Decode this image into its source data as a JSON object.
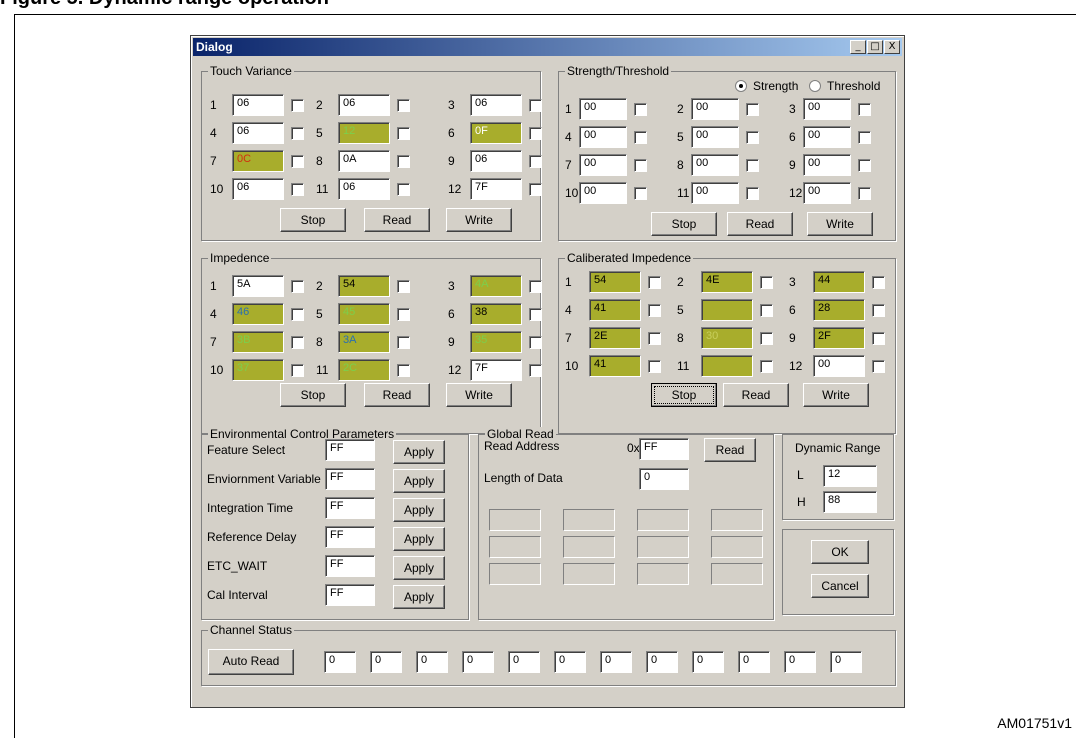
{
  "caption": "Figure 5. Dynamic range operation",
  "footer_code": "AM01751v1",
  "window": {
    "title": "Dialog",
    "minimize": "_",
    "maximize": "□",
    "close": "X"
  },
  "touch_variance": {
    "label": "Touch Variance",
    "cells": [
      {
        "n": "1",
        "v": "06",
        "hl": false
      },
      {
        "n": "2",
        "v": "06",
        "hl": false
      },
      {
        "n": "3",
        "v": "06",
        "hl": false
      },
      {
        "n": "4",
        "v": "06",
        "hl": false
      },
      {
        "n": "5",
        "v": "12",
        "hl": true,
        "color": "#7ccf4c"
      },
      {
        "n": "6",
        "v": "0F",
        "hl": true,
        "color": "#ffffff"
      },
      {
        "n": "7",
        "v": "0C",
        "hl": true,
        "color": "#d03010"
      },
      {
        "n": "8",
        "v": "0A",
        "hl": false
      },
      {
        "n": "9",
        "v": "06",
        "hl": false
      },
      {
        "n": "10",
        "v": "06",
        "hl": false
      },
      {
        "n": "11",
        "v": "06",
        "hl": false
      },
      {
        "n": "12",
        "v": "7F",
        "hl": false
      }
    ],
    "stop": "Stop",
    "read": "Read",
    "write": "Write"
  },
  "strength_threshold": {
    "label": "Strength/Threshold",
    "radio_strength": "Strength",
    "radio_threshold": "Threshold",
    "cells": [
      {
        "n": "1",
        "v": "00"
      },
      {
        "n": "2",
        "v": "00"
      },
      {
        "n": "3",
        "v": "00"
      },
      {
        "n": "4",
        "v": "00"
      },
      {
        "n": "5",
        "v": "00"
      },
      {
        "n": "6",
        "v": "00"
      },
      {
        "n": "7",
        "v": "00"
      },
      {
        "n": "8",
        "v": "00"
      },
      {
        "n": "9",
        "v": "00"
      },
      {
        "n": "10",
        "v": "00"
      },
      {
        "n": "11",
        "v": "00"
      },
      {
        "n": "12",
        "v": "00"
      }
    ],
    "stop": "Stop",
    "read": "Read",
    "write": "Write"
  },
  "impedence": {
    "label": "Impedence",
    "cells": [
      {
        "n": "1",
        "v": "5A",
        "hl": false
      },
      {
        "n": "2",
        "v": "54",
        "hl": true,
        "color": "#000000"
      },
      {
        "n": "3",
        "v": "4A",
        "hl": true,
        "color": "#7ccf4c"
      },
      {
        "n": "4",
        "v": "46",
        "hl": true,
        "color": "#2a6fb0"
      },
      {
        "n": "5",
        "v": "45",
        "hl": true,
        "color": "#7ccf4c"
      },
      {
        "n": "6",
        "v": "38",
        "hl": true,
        "color": "#000000"
      },
      {
        "n": "7",
        "v": "3B",
        "hl": true,
        "color": "#7ccf4c"
      },
      {
        "n": "8",
        "v": "3A",
        "hl": true,
        "color": "#2a6fb0"
      },
      {
        "n": "9",
        "v": "35",
        "hl": true,
        "color": "#7ccf4c"
      },
      {
        "n": "10",
        "v": "37",
        "hl": true,
        "color": "#7ccf4c"
      },
      {
        "n": "11",
        "v": "2C",
        "hl": true,
        "color": "#7ccf4c"
      },
      {
        "n": "12",
        "v": "7F",
        "hl": false
      }
    ],
    "stop": "Stop",
    "read": "Read",
    "write": "Write"
  },
  "calibrated_impedence": {
    "label": "Caliberated Impedence",
    "cells": [
      {
        "n": "1",
        "v": "54",
        "hl": true,
        "color": "#000000"
      },
      {
        "n": "2",
        "v": "4E",
        "hl": true,
        "color": "#000000"
      },
      {
        "n": "3",
        "v": "44",
        "hl": true,
        "color": "#000000"
      },
      {
        "n": "4",
        "v": "41",
        "hl": true,
        "color": "#000000"
      },
      {
        "n": "5",
        "v": "40",
        "hl": true,
        "color": "#a8ad2c"
      },
      {
        "n": "6",
        "v": "28",
        "hl": true,
        "color": "#000000"
      },
      {
        "n": "7",
        "v": "2E",
        "hl": true,
        "color": "#000000"
      },
      {
        "n": "8",
        "v": "30",
        "hl": true,
        "color": "#c8cf5c"
      },
      {
        "n": "9",
        "v": "2F",
        "hl": true,
        "color": "#000000"
      },
      {
        "n": "10",
        "v": "41",
        "hl": true,
        "color": "#000000"
      },
      {
        "n": "11",
        "v": "3E",
        "hl": true,
        "color": "#a8ad2c"
      },
      {
        "n": "12",
        "v": "00",
        "hl": false
      }
    ],
    "stop": "Stop",
    "read": "Read",
    "write": "Write"
  },
  "env_params": {
    "label": "Environmental Control Parameters",
    "apply": "Apply",
    "rows": [
      {
        "label": "Feature Select",
        "value": "FF"
      },
      {
        "label": "Enviornment Variable",
        "value": "FF"
      },
      {
        "label": "Integration Time",
        "value": "FF"
      },
      {
        "label": "Reference Delay",
        "value": "FF"
      },
      {
        "label": "ETC_WAIT",
        "value": "FF"
      },
      {
        "label": "Cal Interval",
        "value": "FF"
      }
    ]
  },
  "global_read": {
    "label": "Global Read",
    "read_address_label": "Read Address",
    "prefix": "0x",
    "address": "FF",
    "read": "Read",
    "length_label": "Length of Data",
    "length": "0"
  },
  "dynamic_range": {
    "label": "Dynamic Range",
    "l_label": "L",
    "l_value": "12",
    "h_label": "H",
    "h_value": "88"
  },
  "ok": "OK",
  "cancel": "Cancel",
  "channel_status": {
    "label": "Channel Status",
    "auto_read": "Auto Read",
    "values": [
      "0",
      "0",
      "0",
      "0",
      "0",
      "0",
      "0",
      "0",
      "0",
      "0",
      "0",
      "0"
    ]
  }
}
